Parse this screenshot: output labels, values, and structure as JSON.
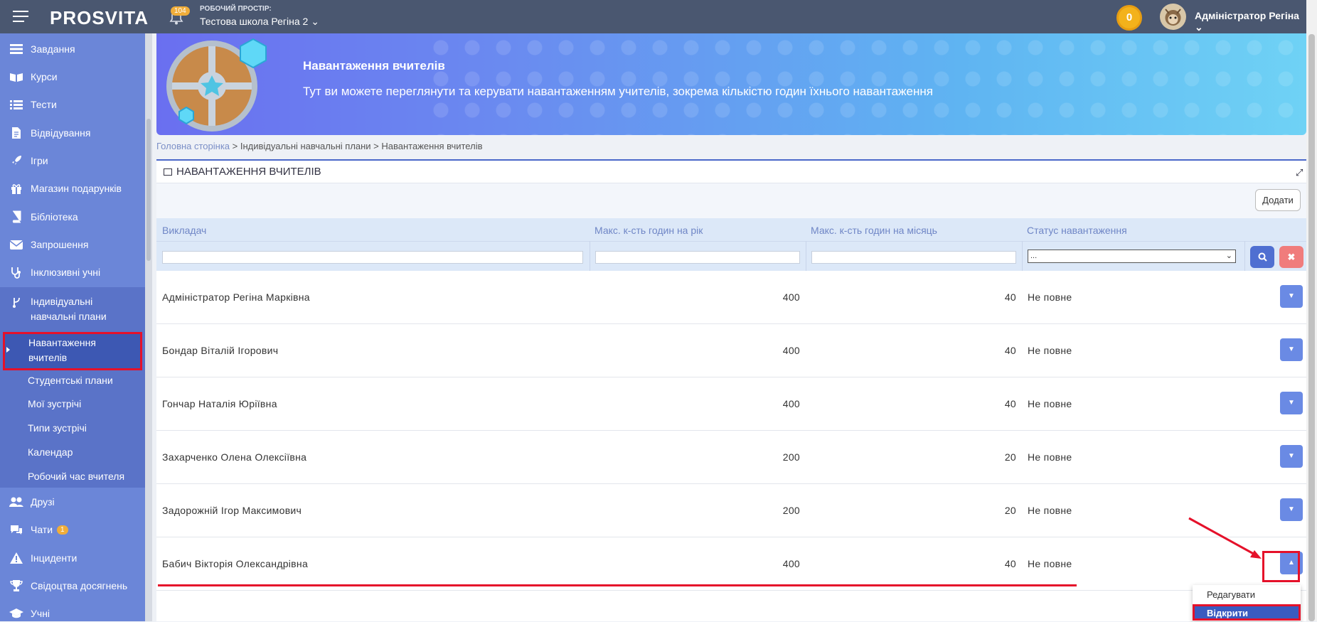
{
  "topbar": {
    "logo": "PROSVITA",
    "notifications_count": "104",
    "workspace_label": "РОБОЧИЙ ПРОСТІР:",
    "workspace_name": "Тестова школа Регіна 2 ⌄",
    "coins": "0",
    "user_name": "Адміністратор Регіна ⌄"
  },
  "sidebar": {
    "items": [
      {
        "label": "Завдання",
        "icon": "tasks-icon"
      },
      {
        "label": "Курси",
        "icon": "book-open-icon"
      },
      {
        "label": "Тести",
        "icon": "list-icon"
      },
      {
        "label": "Відвідування",
        "icon": "document-icon"
      },
      {
        "label": "Ігри",
        "icon": "rocket-icon"
      },
      {
        "label": "Магазин подарунків",
        "icon": "gift-icon"
      },
      {
        "label": "Бібліотека",
        "icon": "book-icon"
      },
      {
        "label": "Запрошення",
        "icon": "envelope-icon"
      },
      {
        "label": "Інклюзивні учні",
        "icon": "stethoscope-icon"
      }
    ],
    "group": {
      "label_line1": "Індивідуальні",
      "label_line2": "навчальні плани",
      "icon": "branch-icon"
    },
    "active_line1": "Навантаження",
    "active_line2": "вчителів",
    "subitems": [
      "Студентські плани",
      "Мої зустрічі",
      "Типи зустрічі",
      "Календар",
      "Робочий час вчителя"
    ],
    "bottom_items": [
      {
        "label": "Друзі",
        "icon": "users-icon"
      },
      {
        "label": "Чати",
        "icon": "chat-icon",
        "badge": "1"
      },
      {
        "label": "Інциденти",
        "icon": "warning-icon"
      },
      {
        "label": "Свідоцтва досягнень",
        "icon": "trophy-icon"
      },
      {
        "label": "Учні",
        "icon": "graduation-cap-icon"
      }
    ]
  },
  "banner": {
    "title": "Навантаження вчителів",
    "subtitle": "Тут ви можете переглянути та керувати навантаженням учителів, зокрема кількістю годин їхнього навантаження"
  },
  "breadcrumb": {
    "home": "Головна сторінка",
    "rest": " > Індивідуальні навчальні плани > Навантаження вчителів"
  },
  "panel": {
    "title": "НАВАНТАЖЕННЯ ВЧИТЕЛІВ",
    "add_label": "Додати"
  },
  "table": {
    "columns": [
      "Викладач",
      "Макс. к-сть годин на рік",
      "Макс. к-сть годин на місяць",
      "Статус навантаження"
    ],
    "status_filter_value": "...",
    "rows": [
      {
        "teacher": "Адміністратор Регіна Марківна",
        "year": "400",
        "month": "40",
        "status": "Не повне"
      },
      {
        "teacher": "Бондар Віталій Ігорович",
        "year": "400",
        "month": "40",
        "status": "Не повне"
      },
      {
        "teacher": "Гончар Наталія Юріївна",
        "year": "400",
        "month": "40",
        "status": "Не повне"
      },
      {
        "teacher": "Захарченко Олена Олексіївна",
        "year": "200",
        "month": "20",
        "status": "Не повне"
      },
      {
        "teacher": "Задорожній Ігор Максимович",
        "year": "200",
        "month": "20",
        "status": "Не повне"
      },
      {
        "teacher": "Бабич Вікторія Олександрівна",
        "year": "400",
        "month": "40",
        "status": "Не повне"
      }
    ]
  },
  "dropdown": {
    "edit_label": "Редагувати",
    "open_label": "Відкрити"
  },
  "colors": {
    "sidebar": "#6b86d8",
    "topbar": "#4a5770",
    "highlight": "#e5112a",
    "accent": "#4f6fd1"
  }
}
